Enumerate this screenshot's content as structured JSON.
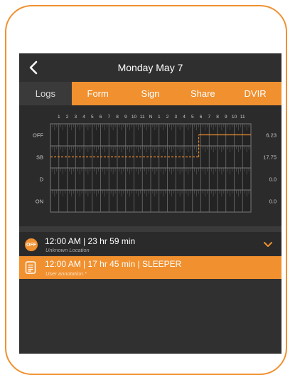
{
  "header": {
    "back_label": "<",
    "title": "Monday May 7"
  },
  "tabs": [
    {
      "label": "Logs",
      "active": true
    },
    {
      "label": "Form",
      "active": false
    },
    {
      "label": "Sign",
      "active": false
    },
    {
      "label": "Share",
      "active": false
    },
    {
      "label": "DVIR",
      "active": false
    }
  ],
  "chart_data": {
    "type": "line",
    "hour_labels": [
      "1",
      "2",
      "3",
      "4",
      "5",
      "6",
      "7",
      "8",
      "9",
      "10",
      "11",
      "N",
      "1",
      "2",
      "3",
      "4",
      "5",
      "6",
      "7",
      "8",
      "9",
      "10",
      "11"
    ],
    "status_rows": [
      {
        "label": "OFF",
        "total": "6.23"
      },
      {
        "label": "SB",
        "total": "17.75"
      },
      {
        "label": "D",
        "total": "0.0"
      },
      {
        "label": "ON",
        "total": "0.0"
      }
    ],
    "series": [
      {
        "values": [
          {
            "start": 0,
            "end": 17.75,
            "status": "SB"
          },
          {
            "start": 17.75,
            "end": 24,
            "status": "OFF"
          }
        ]
      }
    ],
    "x_range": [
      0,
      24
    ]
  },
  "log_event": {
    "badge": "OFF",
    "summary": "12:00 AM | 23 hr 59 min",
    "location": "Unknown Location"
  },
  "annotation_event": {
    "summary": "12:00 AM | 17 hr 45 min | SLEEPER",
    "note": "User annotation.*"
  },
  "colors": {
    "accent": "#f0902f",
    "background": "#303030"
  }
}
